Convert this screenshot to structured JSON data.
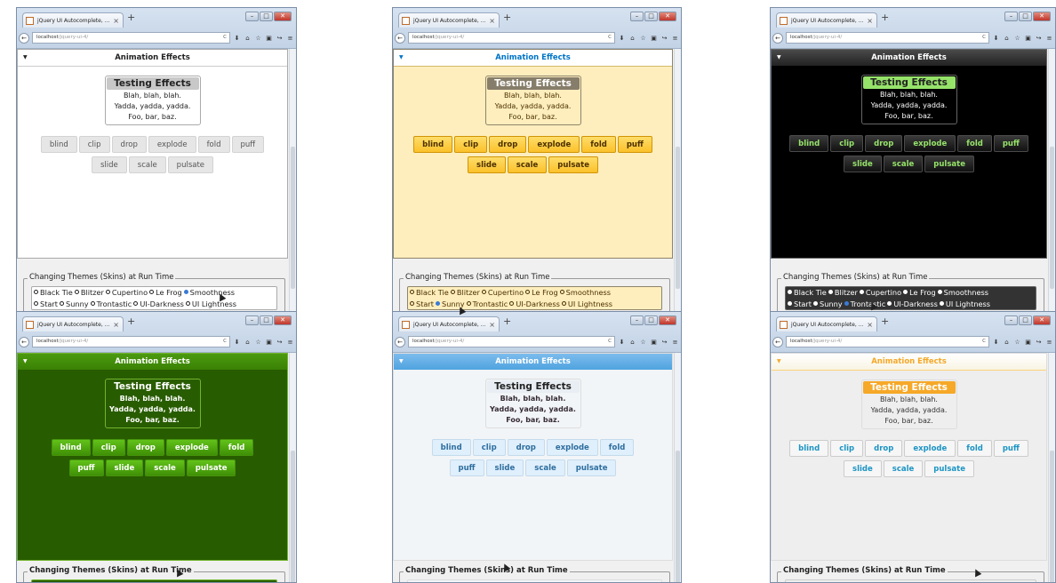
{
  "browser": {
    "tab_title": "jQuery UI Autocomplete, ...",
    "tab_close": "×",
    "new_tab": "+",
    "url_host": "localhost",
    "url_path": "/jquery-ui-4/",
    "reload": "C",
    "win_min": "–",
    "win_max": "□",
    "win_close": "✕"
  },
  "app": {
    "header_title": "Animation Effects",
    "header_arrow": "▼",
    "effects_title": "Testing Effects",
    "lines": [
      "Blah, blah, blah.",
      "Yadda, yadda, yadda.",
      "Foo, bar, baz."
    ],
    "buttons": [
      "blind",
      "clip",
      "drop",
      "explode",
      "fold",
      "puff",
      "slide",
      "scale",
      "pulsate"
    ],
    "themes_legend": "Changing Themes (Skins) at Run Time",
    "themes": [
      "Black Tie",
      "Blitzer",
      "Cupertino",
      "Le Frog",
      "Smoothness",
      "Start",
      "Sunny",
      "Trontastic",
      "UI-Darkness",
      "UI Lightness"
    ]
  },
  "panels": [
    {
      "theme": "Smoothness",
      "colors": {
        "content_bg": "#ffffff",
        "header_bg": "#e6e6e6",
        "header_fg": "#222222",
        "box_bg": "#ffffff",
        "box_border": "#aaaaaa",
        "title_bg": "#c8c8c8",
        "text": "#222222",
        "btn_bg": "#e6e6e6",
        "btn_fg": "#555555",
        "btn_border": "#d3d3d3",
        "opts_bg": "#ffffff",
        "opts_fg": "#222222",
        "opts_border": "#aaaaaa"
      }
    },
    {
      "theme": "Sunny",
      "colors": {
        "content_bg": "#feeebd",
        "header_bg": "#ffffff",
        "header_fg": "#0074c7",
        "box_bg": "#feeebd",
        "box_border": "#8e846b",
        "title_bg": "#867d6a",
        "text": "#4c3000",
        "btn_bg": "#fece2f",
        "btn_fg": "#4c3000",
        "btn_border": "#d19405",
        "opts_bg": "#feeebd",
        "opts_fg": "#4c3000",
        "opts_border": "#8e846b"
      }
    },
    {
      "theme": "UI-Darkness",
      "colors": {
        "content_bg": "#000000",
        "header_bg": "#333333",
        "header_fg": "#ffffff",
        "box_bg": "#000000",
        "box_border": "#666666",
        "title_bg": "#96e36a",
        "text": "#ffffff",
        "btn_bg": "#2a2a2a",
        "btn_fg": "#96e36a",
        "btn_border": "#4a4a4a",
        "opts_bg": "#333333",
        "opts_fg": "#ffffff",
        "opts_border": "#666666"
      }
    },
    {
      "theme": "Le Frog",
      "colors": {
        "content_bg": "#285c00",
        "header_bg": "#3a8104",
        "header_fg": "#ffffff",
        "box_bg": "#285c00",
        "box_border": "#72b42d",
        "title_bg": "#285c00",
        "text": "#ffffff",
        "btn_bg": "#4ca20b",
        "btn_fg": "#ffffff",
        "btn_border": "#45930b",
        "opts_bg": "#285c00",
        "opts_fg": "#ffffff",
        "opts_border": "#72b42d"
      }
    },
    {
      "theme": "Cupertino",
      "colors": {
        "content_bg": "#f2f5f7",
        "header_bg": "#4fa3e0",
        "header_fg": "#ffffff",
        "box_bg": "#f2f5f7",
        "box_border": "#dddddd",
        "title_bg": "#e8eef3",
        "text": "#362b36",
        "btn_bg": "#dfeffc",
        "btn_fg": "#2e6e9e",
        "btn_border": "#c5dbec",
        "opts_bg": "#f2f5f7",
        "opts_fg": "#362b36",
        "opts_border": "#dddddd"
      }
    },
    {
      "theme": "UI Lightness",
      "colors": {
        "content_bg": "#eeeeee",
        "header_bg": "#fbf9ee",
        "header_fg": "#ffffff",
        "box_bg": "#eeeeee",
        "box_border": "#dddddd",
        "title_bg": "#f6a828",
        "text": "#333333",
        "btn_bg": "#f6f6f6",
        "btn_fg": "#1c94c4",
        "btn_border": "#cccccc",
        "opts_bg": "#eeeeee",
        "opts_fg": "#333333",
        "opts_border": "#cccccc"
      }
    }
  ]
}
